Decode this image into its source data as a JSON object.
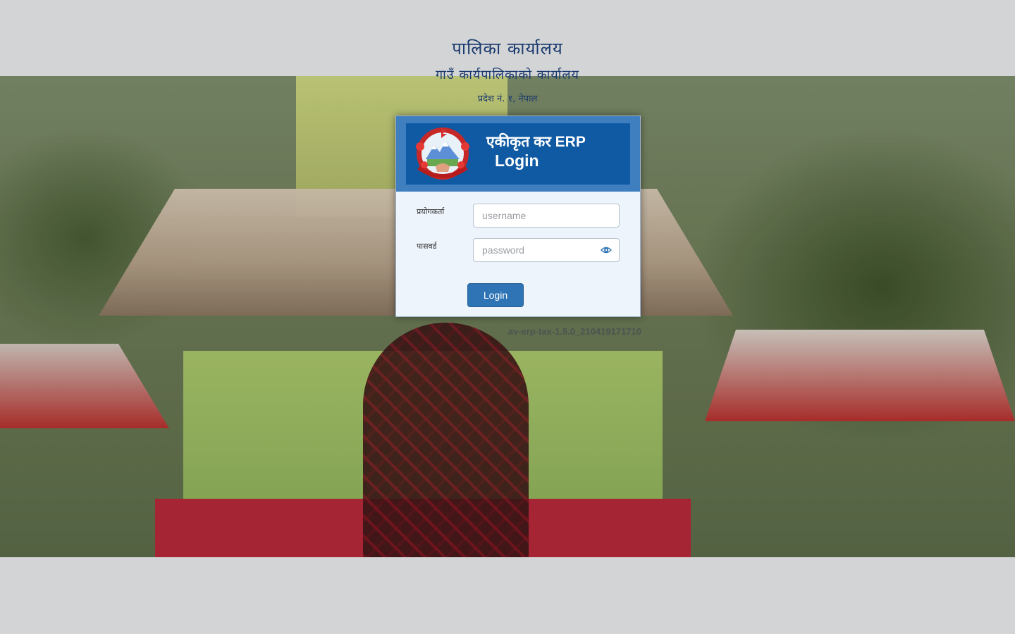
{
  "header": {
    "org_name": "पालिका कार्यालय",
    "office_name": "गाउँ कार्यपालिकाको कार्यालय",
    "address": "प्रदेश नं. १, नेपाल"
  },
  "login_card": {
    "title_line1": "एकीकृत कर ERP",
    "title_line2": "Login",
    "emblem_icon": "nepal-government-emblem",
    "username_label": "प्रयोगकर्ता",
    "username_placeholder": "username",
    "password_label": "पासवर्ड",
    "password_placeholder": "password",
    "show_password_icon": "eye-icon",
    "login_button": "Login"
  },
  "footer": {
    "version": "av-erp-tax-1.5.0_210419171710"
  },
  "colors": {
    "header_text": "#1a3a6e",
    "card_header": "#0f5aa3",
    "card_header_border": "#3f7fbf",
    "card_body": "#eef4fc",
    "button": "#2f74b5",
    "page_background": "#d3d4d6"
  }
}
